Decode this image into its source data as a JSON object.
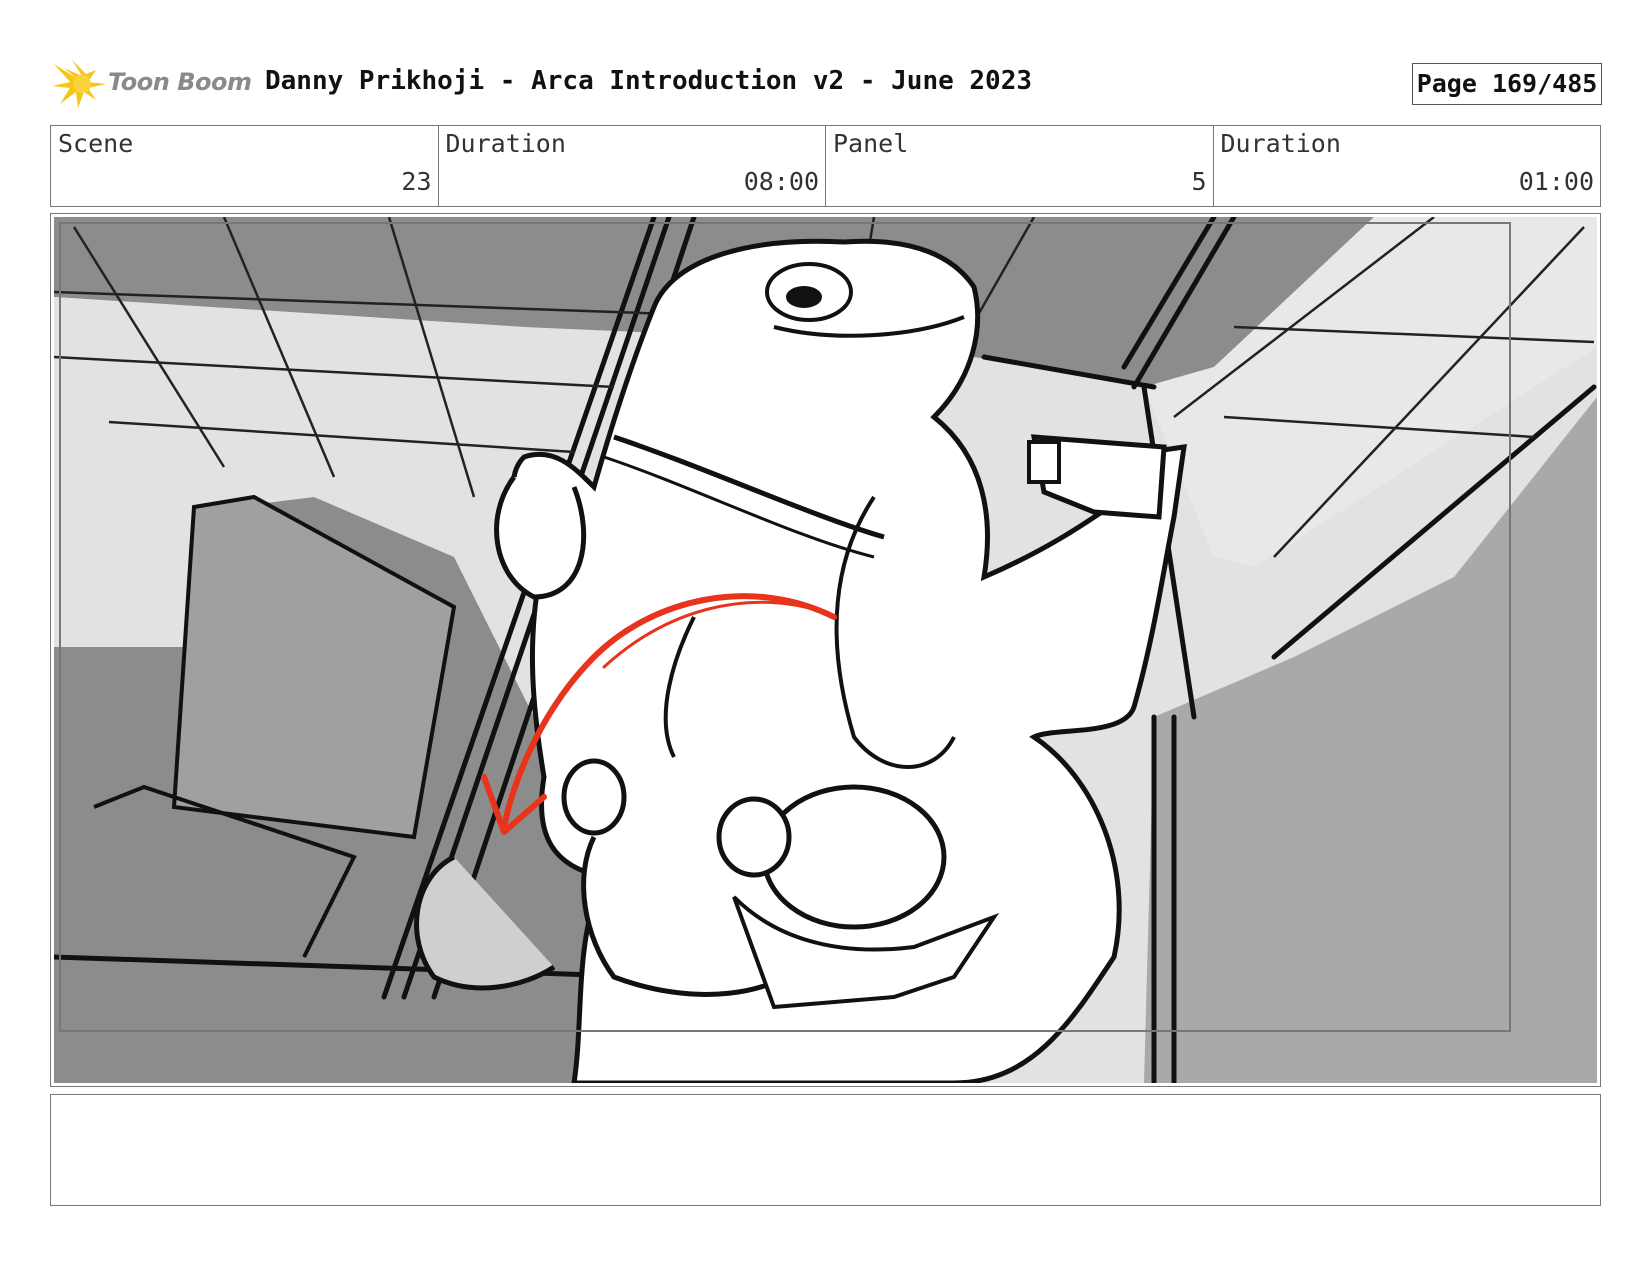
{
  "header": {
    "logo_text": "Toon Boom",
    "title": "Danny Prikhoji - Arca Introduction v2 - June 2023",
    "page": "Page 169/485"
  },
  "info": {
    "scene_label": "Scene",
    "scene_value": "23",
    "scene_duration_label": "Duration",
    "scene_duration_value": "08:00",
    "panel_label": "Panel",
    "panel_value": "5",
    "panel_duration_label": "Duration",
    "panel_duration_value": "01:00"
  },
  "colors": {
    "logo_yellow": "#f5c518",
    "action_arrow": "#e8341c",
    "shade_dark": "#8c8c8c",
    "shade_mid": "#a9a9a9",
    "shade_light": "#e2e2e2"
  },
  "icons": [
    "toon-boom-logo-icon",
    "action-arrow"
  ]
}
